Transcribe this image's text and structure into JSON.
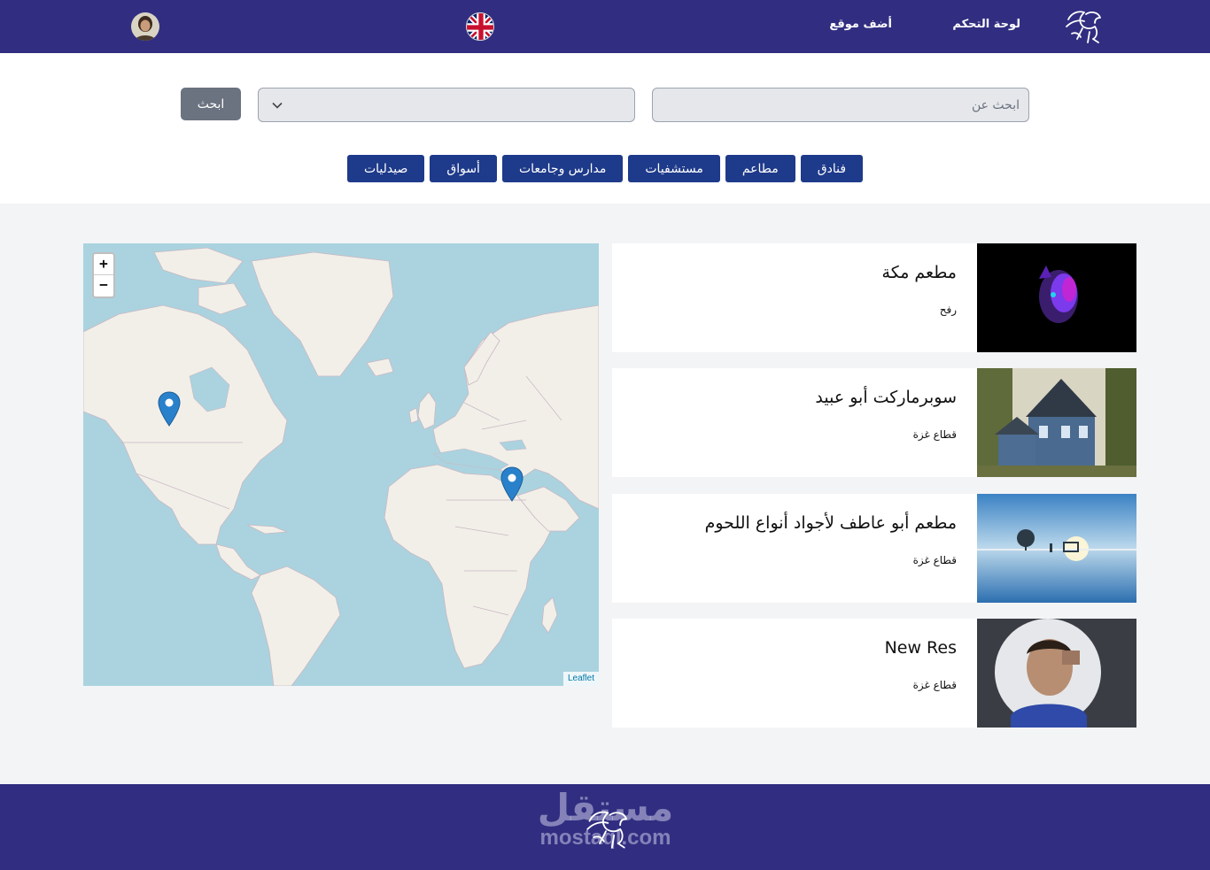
{
  "navbar": {
    "logo_icon": "pegasus-logo-icon",
    "links": {
      "dashboard": "لوحة التحكم",
      "add_site": "أضف موقع"
    },
    "language_icon": "uk-flag-icon",
    "avatar_icon": "user-avatar"
  },
  "search": {
    "placeholder": "ابحث عن",
    "select_value": "",
    "button_label": "ابحث"
  },
  "categories": [
    "فنادق",
    "مطاعم",
    "مستشفيات",
    "مدارس وجامعات",
    "أسواق",
    "صيدليات"
  ],
  "map": {
    "zoom_in": "+",
    "zoom_out": "−",
    "attribution": "Leaflet",
    "colors": {
      "water": "#aad3df",
      "land": "#f2efe9",
      "marker": "#2a81cb"
    }
  },
  "places": [
    {
      "title": "مطعم مكة",
      "location": "رفح",
      "image": "groot-image"
    },
    {
      "title": "سوبرماركت أبو عبيد",
      "location": "قطاع غزة",
      "image": "house-image"
    },
    {
      "title": "مطعم أبو عاطف لأجواد أنواع اللحوم",
      "location": "قطاع غزة",
      "image": "lake-sunset-image"
    },
    {
      "title": "New Res",
      "location": "قطاع غزة",
      "image": "person-photo"
    }
  ],
  "footer": {
    "brand": "مستقل",
    "domain": "mostaql.com"
  },
  "colors": {
    "primary": "#312e81",
    "category_button": "#1e3a8a",
    "search_button": "#6b7280"
  }
}
